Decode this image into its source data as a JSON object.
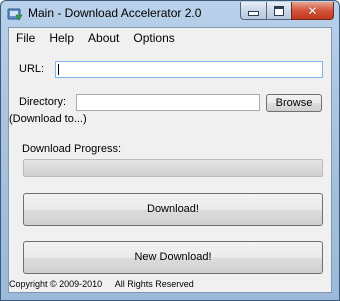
{
  "window": {
    "title": "Main - Download Accelerator 2.0",
    "minimize_icon": "minimize-icon",
    "maximize_icon": "maximize-icon",
    "close_icon": "close-icon",
    "close_glyph": "✕"
  },
  "menu": {
    "items": [
      {
        "label": "File"
      },
      {
        "label": "Help"
      },
      {
        "label": "About"
      },
      {
        "label": "Options"
      }
    ]
  },
  "form": {
    "url_label": "URL:",
    "url_value": "",
    "directory_label": "Directory:",
    "directory_hint": "(Download to...)",
    "directory_value": "",
    "browse_label": "Browse",
    "progress_label": "Download Progress:",
    "progress_fraction": 0
  },
  "actions": {
    "download_label": "Download!",
    "new_download_label": "New Download!"
  },
  "footer": {
    "copyright": "Copyright © 2009-2010",
    "rights": "All Rights Reserved"
  },
  "colors": {
    "titlebar": "#b9d1ea",
    "client_bg": "#f0f0f0",
    "close_button": "#c0381c",
    "url_focus_border": "#7eb4ea"
  }
}
